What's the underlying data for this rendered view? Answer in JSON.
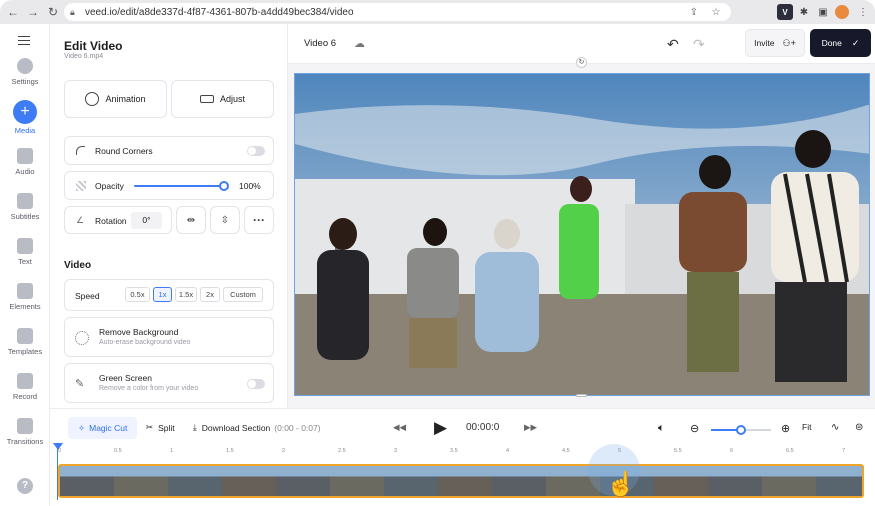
{
  "browser": {
    "url": "veed.io/edit/a8de337d-4f87-4361-807b-a4dd49bec384/video",
    "profile_initial": "V"
  },
  "rail": {
    "items": [
      {
        "label": "Settings",
        "icon": "settings-icon"
      },
      {
        "label": "Media",
        "icon": "plus-icon",
        "active": true
      },
      {
        "label": "Audio",
        "icon": "audio-icon"
      },
      {
        "label": "Subtitles",
        "icon": "subtitles-icon"
      },
      {
        "label": "Text",
        "icon": "text-icon"
      },
      {
        "label": "Elements",
        "icon": "elements-icon"
      },
      {
        "label": "Templates",
        "icon": "templates-icon"
      },
      {
        "label": "Record",
        "icon": "record-icon"
      },
      {
        "label": "Transitions",
        "icon": "transitions-icon"
      }
    ],
    "help": "?"
  },
  "panel": {
    "title": "Edit Video",
    "subtitle": "Video 6.mp4",
    "animation_label": "Animation",
    "adjust_label": "Adjust",
    "round_corners_label": "Round Corners",
    "opacity_label": "Opacity",
    "opacity_value": "100%",
    "opacity_fraction": 1.0,
    "rotation_label": "Rotation",
    "rotation_value": "0°",
    "video_section": "Video",
    "speed_label": "Speed",
    "speed_options": [
      "0.5x",
      "1x",
      "1.5x",
      "2x",
      "Custom"
    ],
    "speed_selected": "1x",
    "remove_bg_title": "Remove Background",
    "remove_bg_desc": "Auto-erase background video",
    "green_screen_title": "Green Screen",
    "green_screen_desc": "Remove a color from your video"
  },
  "header": {
    "project_name": "Video 6",
    "invite_label": "Invite",
    "done_label": "Done"
  },
  "timeline": {
    "magic_cut_label": "Magic Cut",
    "split_label": "Split",
    "download_label": "Download Section",
    "download_range": "(0:00 - 0:07)",
    "timecode": "00:00:0",
    "fit_label": "Fit",
    "ruler": [
      "0",
      "0.5",
      "1",
      "1.5",
      "2",
      "2.5",
      "3",
      "3.5",
      "4",
      "4.5",
      "5",
      "5.5",
      "6",
      "6.5",
      "7"
    ]
  },
  "colors": {
    "accent": "#3d7cf5",
    "done_bg": "#17192a",
    "strip_border": "#f0a52a"
  }
}
